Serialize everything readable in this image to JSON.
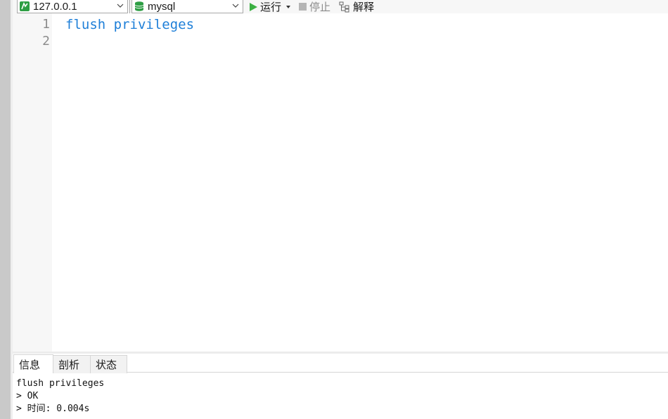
{
  "toolbar": {
    "connection": {
      "value": "127.0.0.1",
      "icon": "connection-icon"
    },
    "database": {
      "value": "mysql",
      "icon": "database-icon"
    },
    "run_label": "运行",
    "stop_label": "停止",
    "explain_label": "解释"
  },
  "editor": {
    "line_numbers": [
      "1",
      "2"
    ],
    "lines": [
      "flush privileges",
      ""
    ],
    "keyword_color": "#1e7fd8"
  },
  "result_tabs": [
    {
      "label": "信息",
      "active": true
    },
    {
      "label": "剖析",
      "active": false
    },
    {
      "label": "状态",
      "active": false
    }
  ],
  "output": {
    "lines": [
      "flush privileges",
      "> OK",
      "> 时间: 0.004s"
    ]
  },
  "colors": {
    "run_green": "#3cb043",
    "db_green": "#2e9e44"
  }
}
